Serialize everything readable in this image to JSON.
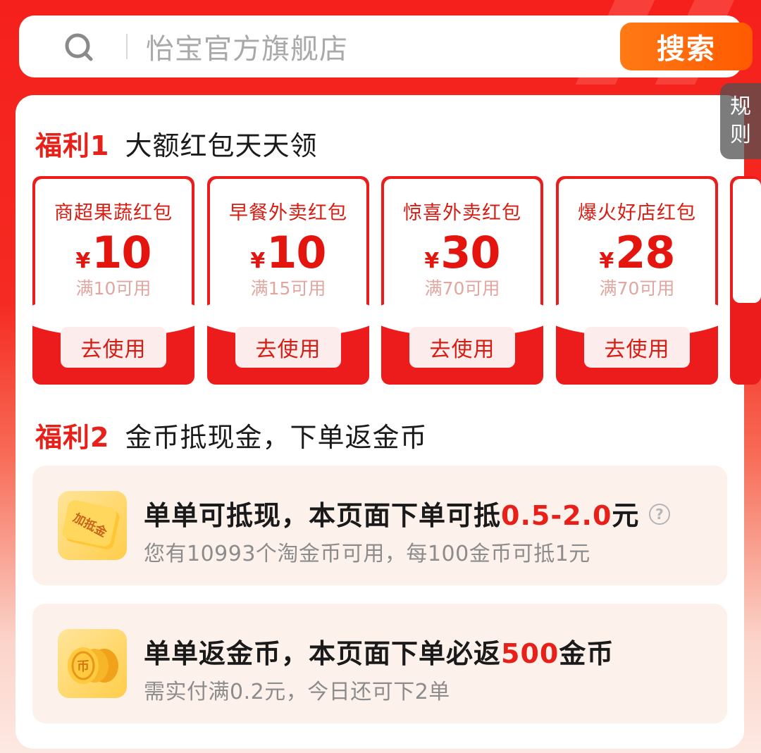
{
  "search": {
    "placeholder": "怡宝官方旗舰店",
    "button_label": "搜索"
  },
  "rules_tab": {
    "line1": "规",
    "line2": "则"
  },
  "benefit1": {
    "tag": "福利1",
    "title": "大额红包天天领",
    "coupons": [
      {
        "name": "商超果蔬红包",
        "currency": "¥",
        "amount": "10",
        "condition": "满10可用",
        "button": "去使用"
      },
      {
        "name": "早餐外卖红包",
        "currency": "¥",
        "amount": "10",
        "condition": "满15可用",
        "button": "去使用"
      },
      {
        "name": "惊喜外卖红包",
        "currency": "¥",
        "amount": "30",
        "condition": "满70可用",
        "button": "去使用"
      },
      {
        "name": "爆火好店红包",
        "currency": "¥",
        "amount": "28",
        "condition": "满70可用",
        "button": "去使用"
      }
    ]
  },
  "benefit2": {
    "tag": "福利2",
    "title": "金币抵现金，下单返金币",
    "items": [
      {
        "icon": "cash-deduct-icon",
        "icon_text": "加抵金",
        "title_prefix": "单单可抵现，本页面下单可抵",
        "title_highlight": "0.5-2.0",
        "title_suffix": "元",
        "subtitle": "您有10993个淘金币可用，每100金币可抵1元"
      },
      {
        "icon": "gold-coins-icon",
        "title_prefix": "单单返金币，本页面下单必返",
        "title_highlight": "500",
        "title_suffix": "金币",
        "subtitle": "需实付满0.2元，今日还可下2单"
      }
    ]
  },
  "colors": {
    "brand_red": "#e8201a",
    "search_button": "#ff6a0a",
    "muted_text": "#8c8c8c"
  }
}
